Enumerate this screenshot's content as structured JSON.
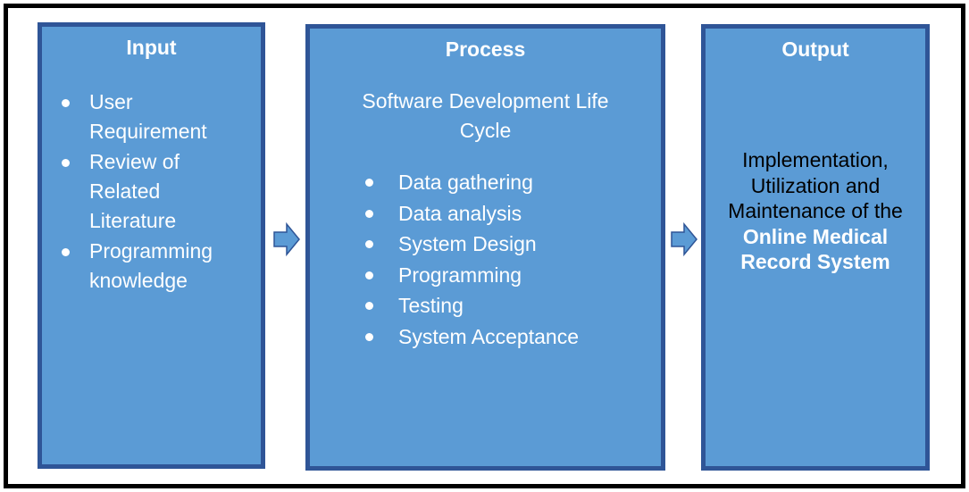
{
  "diagram": {
    "input": {
      "title": "Input",
      "items": [
        {
          "lines": [
            "User",
            "Requirement"
          ]
        },
        {
          "lines": [
            "Review of",
            "Related",
            "Literature"
          ]
        },
        {
          "lines": [
            "Programming",
            "knowledge"
          ]
        }
      ]
    },
    "process": {
      "title": "Process",
      "subtitle_lines": [
        "Software Development Life",
        "Cycle"
      ],
      "items": [
        "Data gathering",
        "Data analysis",
        "System Design",
        "Programming",
        "Testing",
        "System Acceptance"
      ]
    },
    "output": {
      "title": "Output",
      "text_lines": [
        "Implementation,",
        "Utilization and",
        "Maintenance of the"
      ],
      "emphasis_lines": [
        "Online Medical",
        "Record System"
      ]
    },
    "arrows": [
      "input-to-process",
      "process-to-output"
    ],
    "colors": {
      "box_fill": "#5B9BD5",
      "box_border": "#2F5597",
      "frame_border": "#000000"
    }
  }
}
